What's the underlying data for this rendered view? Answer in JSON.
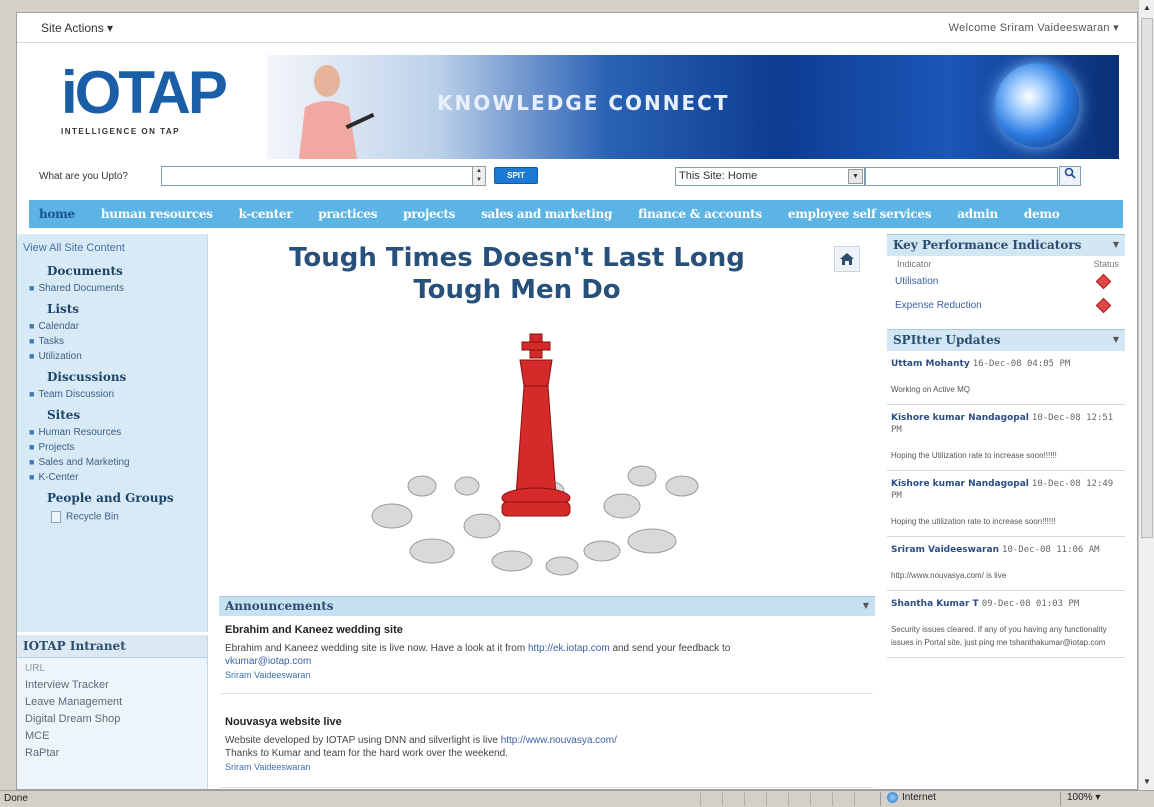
{
  "topbar": {
    "site_actions": "Site Actions ▾",
    "welcome": "Welcome Sriram Vaideeswaran  ▾"
  },
  "logo": {
    "brand": "iOTAP",
    "tagline": "INTELLIGENCE ON TAP"
  },
  "banner": {
    "headline": "KNOWLEDGE CONNECT"
  },
  "search": {
    "label": "What are you Upto?",
    "spit_button": "SPIT",
    "scope": "This Site: Home",
    "go_icon": "search-icon"
  },
  "nav": {
    "tabs": [
      "home",
      "human resources",
      "k-center",
      "practices",
      "projects",
      "sales and marketing",
      "finance & accounts",
      "employee self services",
      "admin",
      "demo"
    ]
  },
  "leftnav": {
    "view_all": "View All Site Content",
    "documents": {
      "header": "Documents",
      "items": [
        "Shared Documents"
      ]
    },
    "lists": {
      "header": "Lists",
      "items": [
        "Calendar",
        "Tasks",
        "Utilization"
      ]
    },
    "discussions": {
      "header": "Discussions",
      "items": [
        "Team Discussion"
      ]
    },
    "sites": {
      "header": "Sites",
      "items": [
        "Human Resources",
        "Projects",
        "Sales and Marketing",
        "K-Center"
      ]
    },
    "people": {
      "header": "People and Groups"
    },
    "recycle_bin": "Recycle Bin"
  },
  "intranet": {
    "title": "IOTAP Intranet",
    "url_label": "URL",
    "links": [
      "Interview Tracker",
      "Leave Management",
      "Digital Dream Shop",
      "MCE",
      "RaPtar"
    ]
  },
  "center": {
    "quote_line1": "Tough Times Doesn't Last Long",
    "quote_line2": "Tough Men Do"
  },
  "announcements": {
    "header": "Announcements",
    "items": [
      {
        "title": "Ebrahim and Kaneez wedding site",
        "body": "Ebrahim and Kaneez wedding site is live now. Have a look at it from",
        "link": "http://ek.iotap.com",
        "body2": "and send your feedback to",
        "email": "vkumar@iotap.com",
        "author": "Sriram Vaideeswaran"
      },
      {
        "title": "Nouvasya website live",
        "body": "Website developed by IOTAP using DNN and silverlight is live",
        "link": "http://www.nouvasya.com/",
        "body2": "Thanks to Kumar and team for the hard work over the weekend.",
        "author": "Sriram Vaideeswaran"
      }
    ]
  },
  "kpi": {
    "header": "Key Performance Indicators",
    "col_indicator": "Indicator",
    "col_status": "Status",
    "rows": [
      {
        "name": "Utilisation",
        "status_color": "#e04848"
      },
      {
        "name": "Expense Reduction",
        "status_color": "#e04848"
      }
    ]
  },
  "spitter": {
    "header": "SPItter Updates",
    "posts": [
      {
        "who": "Uttam Mohanty",
        "when": "16-Dec-08 04:05 PM",
        "msg": "Working on Active MQ"
      },
      {
        "who": "Kishore kumar Nandagopal",
        "when": "10-Dec-08 12:51 PM",
        "msg": "Hoping the Utilization rate to increase soon!!!!!!"
      },
      {
        "who": "Kishore kumar Nandagopal",
        "when": "10-Dec-08 12:49 PM",
        "msg": "Hoping the utilization rate to increase soon!!!!!!"
      },
      {
        "who": "Sriram Vaideeswaran",
        "when": "10-Dec-08 11:06 AM",
        "msg": "http://www.nouvasya.com/ is live"
      },
      {
        "who": "Shantha Kumar T",
        "when": "09-Dec-08 01:03 PM",
        "msg": "Security issues cleared. If any of you having any functionality issues in Portal site, just ping me  tshanthakumar@iotap.com"
      }
    ]
  },
  "statusbar": {
    "done": "Done",
    "zone": "Internet",
    "zoom": "100%"
  }
}
